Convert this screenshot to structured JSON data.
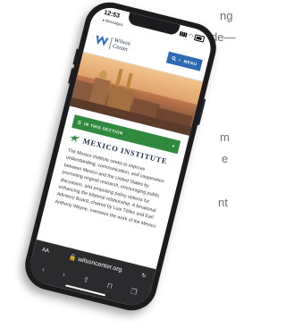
{
  "background_text": [
    "ng",
    "de—",
    "m",
    "e",
    "nt"
  ],
  "status_bar": {
    "time": "12:53",
    "back_label": "◂ Messages"
  },
  "site": {
    "logo_line1": "Wilson",
    "logo_line2": "Center",
    "menu_label": "MENU"
  },
  "section_bar": {
    "label": "IN THIS SECTION"
  },
  "institute": {
    "title": "MEXICO INSTITUTE",
    "body": "The Mexico Institute seeks to improve understanding, communication, and cooperation between Mexico and the United States by promoting original research, encouraging public discussion, and proposing policy options for enhancing the bilateral relationship. A binational Advisory Board, chaired by Luis Téllez and Earl Anthony Wayne, oversees the work of the Mexico"
  },
  "browser": {
    "text_size_label": "AA",
    "url": "wilsoncenter.org"
  },
  "colors": {
    "brand_blue": "#2d6ab4",
    "section_green": "#2f8a3d",
    "navy": "#1b2a4a"
  }
}
